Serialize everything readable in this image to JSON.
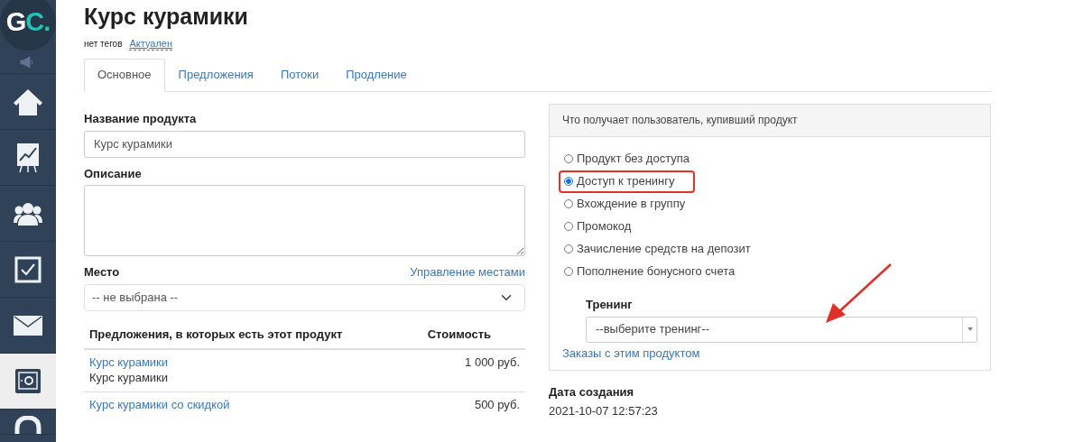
{
  "sidebar": {
    "logo": "GC.",
    "items": [
      {
        "kind": "megaphone",
        "selected": false
      },
      {
        "kind": "home",
        "selected": false
      },
      {
        "kind": "chart",
        "selected": false
      },
      {
        "kind": "people",
        "selected": false
      },
      {
        "kind": "tasks",
        "selected": false
      },
      {
        "kind": "mail",
        "selected": false
      },
      {
        "kind": "safe",
        "selected": true
      },
      {
        "kind": "support",
        "selected": false
      }
    ]
  },
  "title": "Курс курамики",
  "tags": {
    "label": "нет тегов",
    "status": "Актуален"
  },
  "tabs": [
    {
      "label": "Основное",
      "selected": true
    },
    {
      "label": "Предложения",
      "selected": false
    },
    {
      "label": "Потоки",
      "selected": false
    },
    {
      "label": "Продление",
      "selected": false
    }
  ],
  "form": {
    "name_label": "Название продукта",
    "name_value": "Курс курамики",
    "description_label": "Описание",
    "place_label": "Место",
    "place_link": "Управление местами",
    "place_value": "-- не выбрана --"
  },
  "offers_table": {
    "columns": [
      "Предложения, в которых есть этот продукт",
      "Стоимость"
    ],
    "rows": [
      {
        "title": "Курс курамики",
        "subtitle": "Курс курамики",
        "price": "1 000 руб."
      },
      {
        "title": "Курс курамики со скидкой",
        "price": "500 руб."
      }
    ]
  },
  "access_panel": {
    "header": "Что получает пользователь, купивший продукт",
    "options": [
      {
        "label": "Продукт без доступа",
        "selected": false,
        "highlighted": false
      },
      {
        "label": "Доступ к тренингу",
        "selected": true,
        "highlighted": true
      },
      {
        "label": "Вхождение в группу",
        "selected": false,
        "highlighted": false
      },
      {
        "label": "Промокод",
        "selected": false,
        "highlighted": false
      },
      {
        "label": "Зачисление средств на депозит",
        "selected": false,
        "highlighted": false
      },
      {
        "label": "Пополнение бонусного счета",
        "selected": false,
        "highlighted": false
      }
    ],
    "training_label": "Тренинг",
    "training_value": "--выберите тренинг--",
    "orders_link": "Заказы с этим продуктом"
  },
  "created": {
    "label": "Дата создания",
    "value": "2021-10-07 12:57:23"
  }
}
